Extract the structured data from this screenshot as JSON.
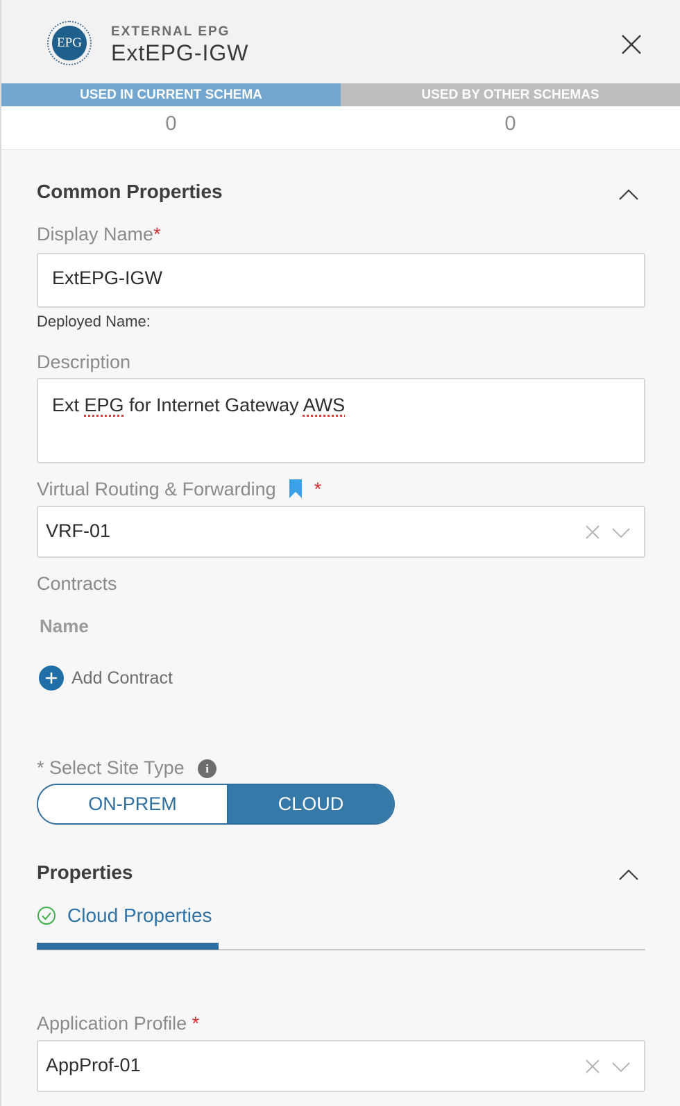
{
  "header": {
    "logo_text": "EPG",
    "kicker": "EXTERNAL EPG",
    "title": "ExtEPG-IGW"
  },
  "usage": {
    "current": {
      "label": "USED IN CURRENT SCHEMA",
      "count": "0"
    },
    "other": {
      "label": "USED BY OTHER SCHEMAS",
      "count": "0"
    }
  },
  "common": {
    "title": "Common Properties",
    "display_name_label": "Display Name",
    "display_name_value": "ExtEPG-IGW",
    "deployed_name_label": "Deployed Name:",
    "description_label": "Description",
    "description_words": [
      "Ext ",
      "EPG",
      " for Internet Gateway ",
      "AWS"
    ],
    "vrf_label": "Virtual Routing & Forwarding",
    "vrf_value": "VRF-01",
    "contracts_label": "Contracts",
    "contracts_name_header": "Name",
    "add_contract": "Add Contract",
    "required_mark": "*"
  },
  "site_type": {
    "label": "Select Site Type",
    "info": "i",
    "options": [
      "ON-PREM",
      "CLOUD"
    ],
    "selected": "CLOUD"
  },
  "properties": {
    "title": "Properties",
    "tab_label": "Cloud Properties",
    "app_profile_label": "Application Profile",
    "app_profile_value": "AppProf-01"
  },
  "colors": {
    "accent": "#2f6fa0",
    "usage_active": "#73a7cf",
    "usage_inactive": "#bdbdbd",
    "required": "#d3302f",
    "bookmark": "#3aa0e8",
    "success": "#3fae49"
  }
}
